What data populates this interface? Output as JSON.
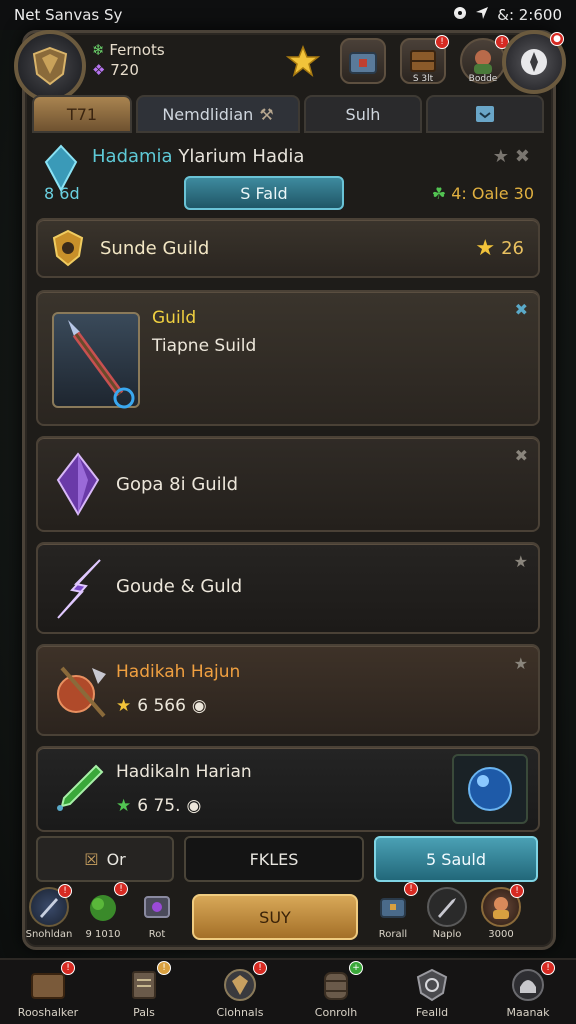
{
  "status_bar": {
    "title": "Net Sanvas Sy",
    "time": "&: 2:600"
  },
  "resources": {
    "line1": "Fernots",
    "line2": "720"
  },
  "top_icons": [
    {
      "name": "star",
      "badge": ""
    },
    {
      "name": "chest",
      "badge": ""
    },
    {
      "name": "crate",
      "badge": "!",
      "caption": "S 3lt"
    },
    {
      "name": "hero",
      "badge": "!",
      "caption": "Bodde"
    }
  ],
  "tabs": [
    {
      "label": "T71"
    },
    {
      "label": "Nemdlidian"
    },
    {
      "label": "Sulh"
    },
    {
      "label": ""
    }
  ],
  "header": {
    "title_colored": "Hadamia",
    "title_rest": "Ylarium Hadia",
    "left_value": "8 6d",
    "pill_label": "S Fald",
    "right_value_green": "4",
    "right_value": "4: Oale 30"
  },
  "rows": [
    {
      "title": "Sunde Guild",
      "value": "26"
    },
    {
      "label1": "Guild",
      "label2": "Tiapne Suild"
    },
    {
      "label": "Gopa 8i Guild"
    },
    {
      "label": "Goude & Guld"
    },
    {
      "title": "Hadikah Hajun",
      "stat": "6 566"
    },
    {
      "title": "Hadikaln Harian",
      "stat": "6 75."
    }
  ],
  "footer_buttons": {
    "left": "Or",
    "middle": "FKLES",
    "right": "5 Sauld"
  },
  "dock": {
    "items_left": [
      {
        "label": "Snohldan"
      },
      {
        "label": "9 1010"
      },
      {
        "label": "Rot"
      }
    ],
    "center_label": "SUY",
    "items_right": [
      {
        "label": "Rorall"
      },
      {
        "label": "Naplo"
      },
      {
        "label": "3000"
      }
    ]
  },
  "nav": [
    {
      "label": "Rooshalker"
    },
    {
      "label": "Pals"
    },
    {
      "label": "Clohnals"
    },
    {
      "label": "Conrolh"
    },
    {
      "label": "Fealld"
    },
    {
      "label": "Maanak"
    }
  ],
  "colors": {
    "accent_teal": "#4aa0b4",
    "gold": "#d8a858",
    "frame": "#4a4238",
    "panel": "#2a2520"
  }
}
